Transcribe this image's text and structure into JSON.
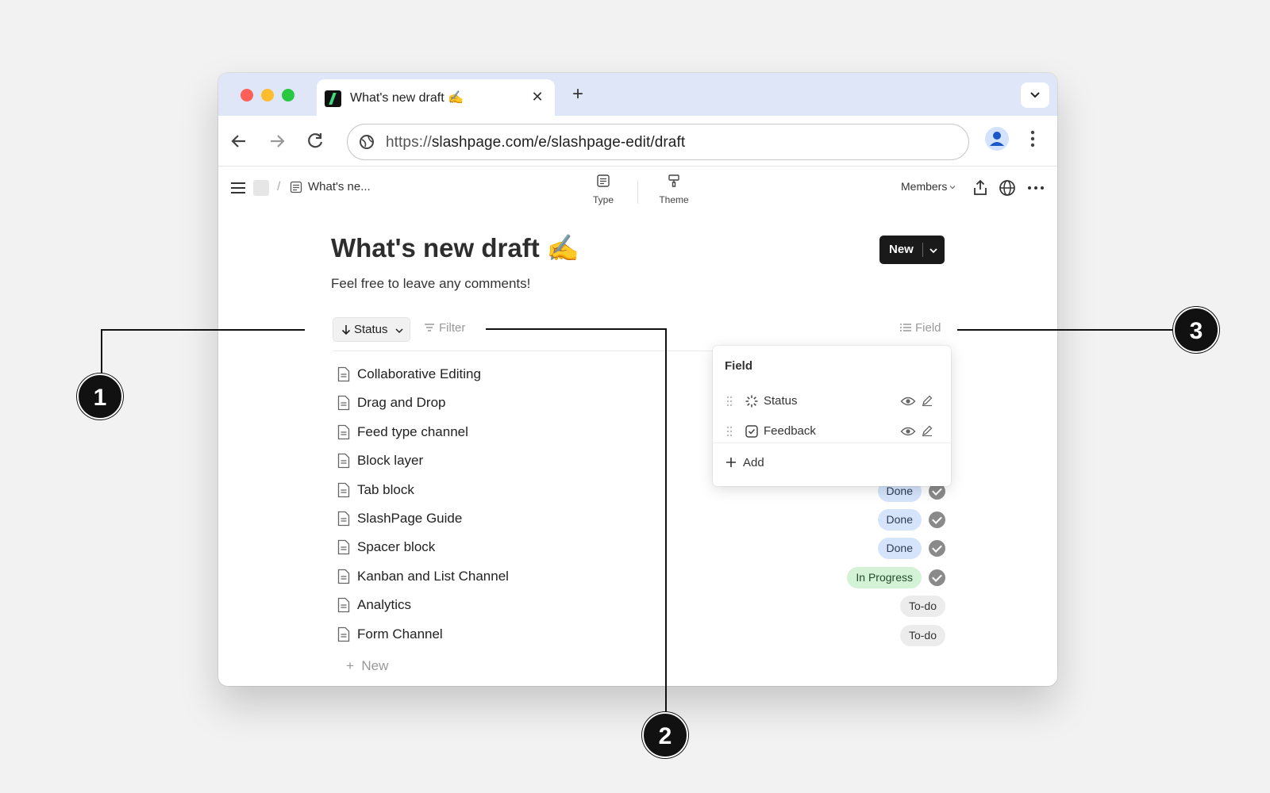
{
  "browser": {
    "tab_title": "What's new draft ✍️",
    "url_scheme": "https://",
    "url_rest": "slashpage.com/e/slashpage-edit/draft"
  },
  "appbar": {
    "breadcrumb": "What's ne...",
    "tool_type": "Type",
    "tool_theme": "Theme",
    "members": "Members"
  },
  "page": {
    "title": "What's new draft ✍️",
    "subtitle": "Feel free to leave any comments!",
    "new_button": "New"
  },
  "controls": {
    "status": "Status",
    "filter": "Filter",
    "field": "Field"
  },
  "items": [
    {
      "name": "Collaborative Editing"
    },
    {
      "name": "Drag and Drop"
    },
    {
      "name": "Feed type channel"
    },
    {
      "name": "Block layer"
    },
    {
      "name": "Tab block",
      "badge": "Done",
      "check": true
    },
    {
      "name": "SlashPage Guide",
      "badge": "Done",
      "check": true
    },
    {
      "name": "Spacer block",
      "badge": "Done",
      "check": true
    },
    {
      "name": "Kanban and List Channel",
      "badge": "In Progress",
      "check": true
    },
    {
      "name": "Analytics",
      "badge": "To-do",
      "check": false
    },
    {
      "name": "Form Channel",
      "badge": "To-do",
      "check": false
    }
  ],
  "add_new": "New",
  "field_popover": {
    "title": "Field",
    "fields": [
      {
        "name": "Status",
        "icon": "loader-icon"
      },
      {
        "name": "Feedback",
        "icon": "checkbox-icon"
      }
    ],
    "add_label": "Add"
  },
  "callouts": [
    "1",
    "2",
    "3"
  ],
  "colors": {
    "tabstrip": "#dfe6f7",
    "done_badge": "#d5e4fb",
    "in_progress_badge": "#d3f2d6",
    "todo_badge": "#ececec",
    "callout": "#111111"
  }
}
